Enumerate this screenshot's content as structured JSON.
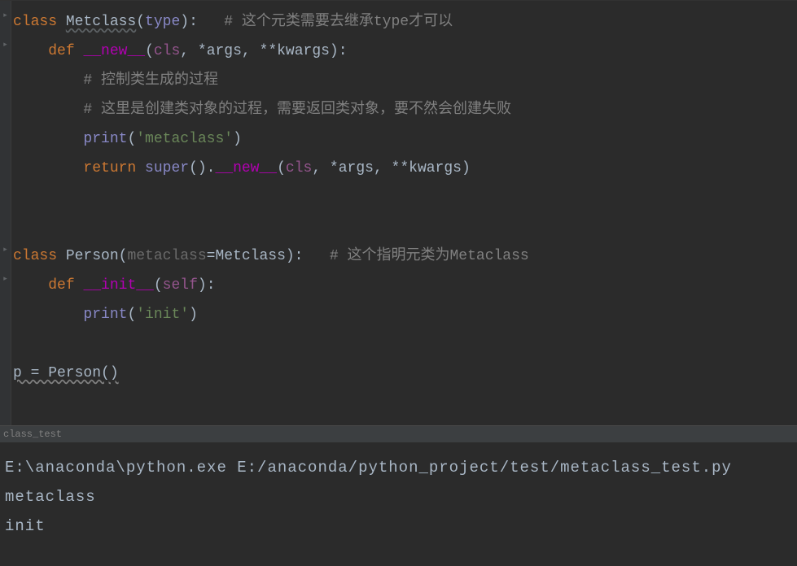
{
  "editor": {
    "lines": [
      [
        {
          "t": "class ",
          "c": "kw"
        },
        {
          "t": "Metclass",
          "c": "classname underline"
        },
        {
          "t": "(",
          "c": "paren"
        },
        {
          "t": "type",
          "c": "builtin"
        },
        {
          "t": "):",
          "c": "paren"
        },
        {
          "t": "   ",
          "c": ""
        },
        {
          "t": "# 这个元类需要去继承type才可以",
          "c": "comment"
        }
      ],
      [
        {
          "t": "    ",
          "c": ""
        },
        {
          "t": "def ",
          "c": "kw"
        },
        {
          "t": "__new__",
          "c": "dunder"
        },
        {
          "t": "(",
          "c": "paren"
        },
        {
          "t": "cls",
          "c": "param-self"
        },
        {
          "t": ", ",
          "c": "punct"
        },
        {
          "t": "*args",
          "c": "op"
        },
        {
          "t": ", ",
          "c": "punct"
        },
        {
          "t": "**kwargs):",
          "c": "paren"
        }
      ],
      [
        {
          "t": "        ",
          "c": ""
        },
        {
          "t": "# 控制类生成的过程",
          "c": "comment"
        }
      ],
      [
        {
          "t": "        ",
          "c": ""
        },
        {
          "t": "# 这里是创建类对象的过程，需要返回类对象，要不然会创建失败",
          "c": "comment"
        }
      ],
      [
        {
          "t": "        ",
          "c": ""
        },
        {
          "t": "print",
          "c": "builtin"
        },
        {
          "t": "(",
          "c": "paren"
        },
        {
          "t": "'metaclass'",
          "c": "string"
        },
        {
          "t": ")",
          "c": "paren"
        }
      ],
      [
        {
          "t": "        ",
          "c": ""
        },
        {
          "t": "return ",
          "c": "kw"
        },
        {
          "t": "super",
          "c": "builtin"
        },
        {
          "t": "().",
          "c": "paren"
        },
        {
          "t": "__new__",
          "c": "dunder"
        },
        {
          "t": "(",
          "c": "paren"
        },
        {
          "t": "cls",
          "c": "param-self"
        },
        {
          "t": ", ",
          "c": "punct"
        },
        {
          "t": "*args",
          "c": "op"
        },
        {
          "t": ", ",
          "c": "punct"
        },
        {
          "t": "**kwargs)",
          "c": "paren"
        }
      ],
      [
        {
          "t": "",
          "c": ""
        }
      ],
      [
        {
          "t": "",
          "c": ""
        }
      ],
      [
        {
          "t": "class ",
          "c": "kw"
        },
        {
          "t": "Person",
          "c": "classname"
        },
        {
          "t": "(",
          "c": "paren"
        },
        {
          "t": "metaclass",
          "c": "param"
        },
        {
          "t": "=Metclass):",
          "c": "paren"
        },
        {
          "t": "   ",
          "c": ""
        },
        {
          "t": "# 这个指明元类为Metaclass",
          "c": "comment"
        }
      ],
      [
        {
          "t": "    ",
          "c": ""
        },
        {
          "t": "def ",
          "c": "kw"
        },
        {
          "t": "__init__",
          "c": "dunder"
        },
        {
          "t": "(",
          "c": "paren"
        },
        {
          "t": "self",
          "c": "param-self"
        },
        {
          "t": "):",
          "c": "paren"
        }
      ],
      [
        {
          "t": "        ",
          "c": ""
        },
        {
          "t": "print",
          "c": "builtin"
        },
        {
          "t": "(",
          "c": "paren"
        },
        {
          "t": "'init'",
          "c": "string"
        },
        {
          "t": ")",
          "c": "paren"
        }
      ],
      [
        {
          "t": "",
          "c": ""
        }
      ],
      [
        {
          "t": "p = Person()",
          "c": "assign-wavy"
        }
      ]
    ],
    "hint_line": ""
  },
  "console": {
    "tab_label": "class_test",
    "output_lines": [
      "E:\\anaconda\\python.exe E:/anaconda/python_project/test/metaclass_test.py",
      "metaclass",
      "init"
    ]
  }
}
